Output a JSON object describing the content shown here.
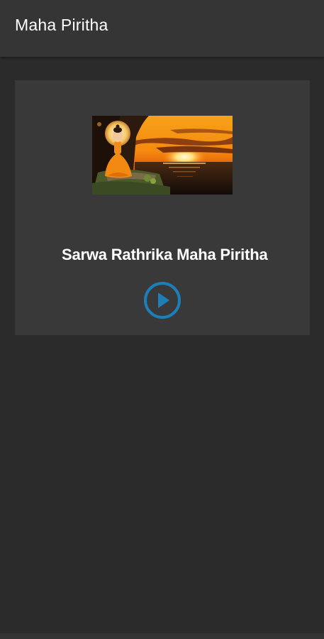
{
  "app_bar": {
    "title": "Maha Piritha"
  },
  "track": {
    "title": "Sarwa Rathrika Maha Piritha",
    "thumbnail": "buddha-meditating-sunset-image",
    "play_icon": "play-icon"
  },
  "colors": {
    "background": "#2b2b2b",
    "app_bar": "#353535",
    "card": "#393939",
    "accent": "#1e7fb8",
    "text": "#ffffff"
  }
}
